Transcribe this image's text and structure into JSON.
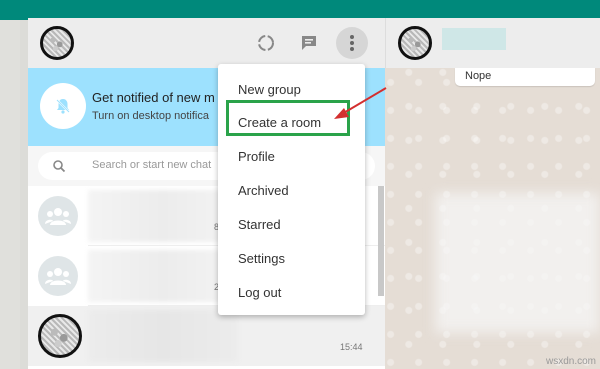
{
  "notification": {
    "title": "Get notified of new m",
    "subtitle": "Turn on desktop notifica"
  },
  "search": {
    "placeholder": "Search or start new chat"
  },
  "chats": [
    {
      "time": "8"
    },
    {
      "time": "2"
    },
    {
      "time": "15:44"
    }
  ],
  "menu": {
    "items": [
      "New group",
      "Create a room",
      "Profile",
      "Archived",
      "Starred",
      "Settings",
      "Log out"
    ],
    "highlighted": "Create a room"
  },
  "conversation": {
    "last_message": "Nope"
  },
  "icons": {
    "status": "status-icon",
    "new_chat": "new-chat-icon",
    "menu": "menu-icon",
    "search": "search-icon",
    "bell": "bell-off-icon",
    "group": "group-icon"
  },
  "colors": {
    "brand": "#00897b",
    "notify_bg": "#9de1fe",
    "highlight": "#2aa34a",
    "annotation_arrow": "#d32f2f"
  },
  "watermark": "wsxdn.com"
}
